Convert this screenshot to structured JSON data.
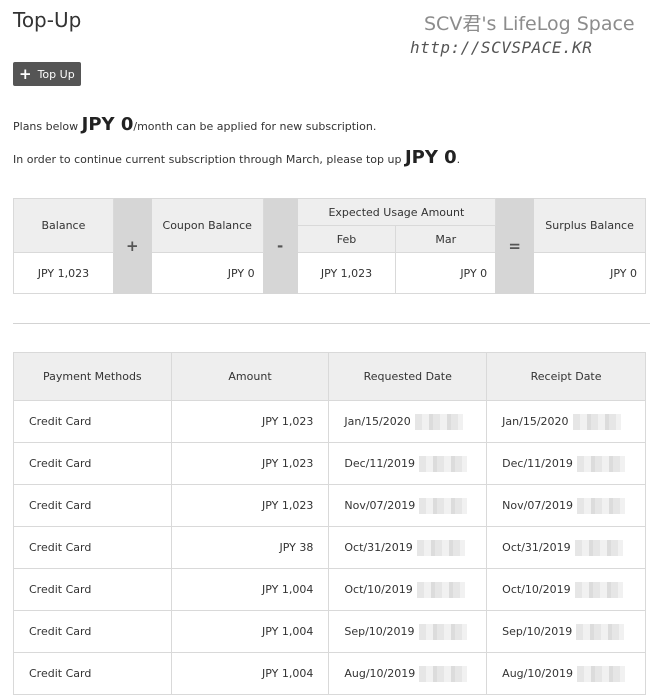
{
  "page": {
    "title": "Top-Up"
  },
  "watermark": {
    "title": "SCV君's LifeLog Space",
    "url": "http://SCVSPACE.KR"
  },
  "toolbar": {
    "topup_label": "Top Up"
  },
  "messages": {
    "line1_pre": "Plans below ",
    "line1_amount": "JPY 0",
    "line1_post": "/month can be applied for new subscription.",
    "line2_pre": "In order to continue current subscription through March, please top up ",
    "line2_amount": "JPY 0",
    "line2_post": "."
  },
  "balance": {
    "headers": {
      "balance": "Balance",
      "plus": "+",
      "coupon": "Coupon Balance",
      "minus": "-",
      "expected": "Expected Usage Amount",
      "feb": "Feb",
      "mar": "Mar",
      "equals": "=",
      "surplus": "Surplus Balance"
    },
    "values": {
      "balance": "JPY 1,023",
      "coupon": "JPY 0",
      "feb": "JPY 1,023",
      "mar": "JPY 0",
      "surplus": "JPY 0"
    }
  },
  "payments": {
    "columns": [
      "Payment Methods",
      "Amount",
      "Requested Date",
      "Receipt Date"
    ],
    "rows": [
      {
        "method": "Credit Card",
        "amount": "JPY 1,023",
        "requested": "Jan/15/2020",
        "receipt": "Jan/15/2020"
      },
      {
        "method": "Credit Card",
        "amount": "JPY 1,023",
        "requested": "Dec/11/2019",
        "receipt": "Dec/11/2019"
      },
      {
        "method": "Credit Card",
        "amount": "JPY 1,023",
        "requested": "Nov/07/2019",
        "receipt": "Nov/07/2019"
      },
      {
        "method": "Credit Card",
        "amount": "JPY 38",
        "requested": "Oct/31/2019",
        "receipt": "Oct/31/2019"
      },
      {
        "method": "Credit Card",
        "amount": "JPY 1,004",
        "requested": "Oct/10/2019",
        "receipt": "Oct/10/2019"
      },
      {
        "method": "Credit Card",
        "amount": "JPY 1,004",
        "requested": "Sep/10/2019",
        "receipt": "Sep/10/2019"
      },
      {
        "method": "Credit Card",
        "amount": "JPY 1,004",
        "requested": "Aug/10/2019",
        "receipt": "Aug/10/2019"
      }
    ]
  }
}
